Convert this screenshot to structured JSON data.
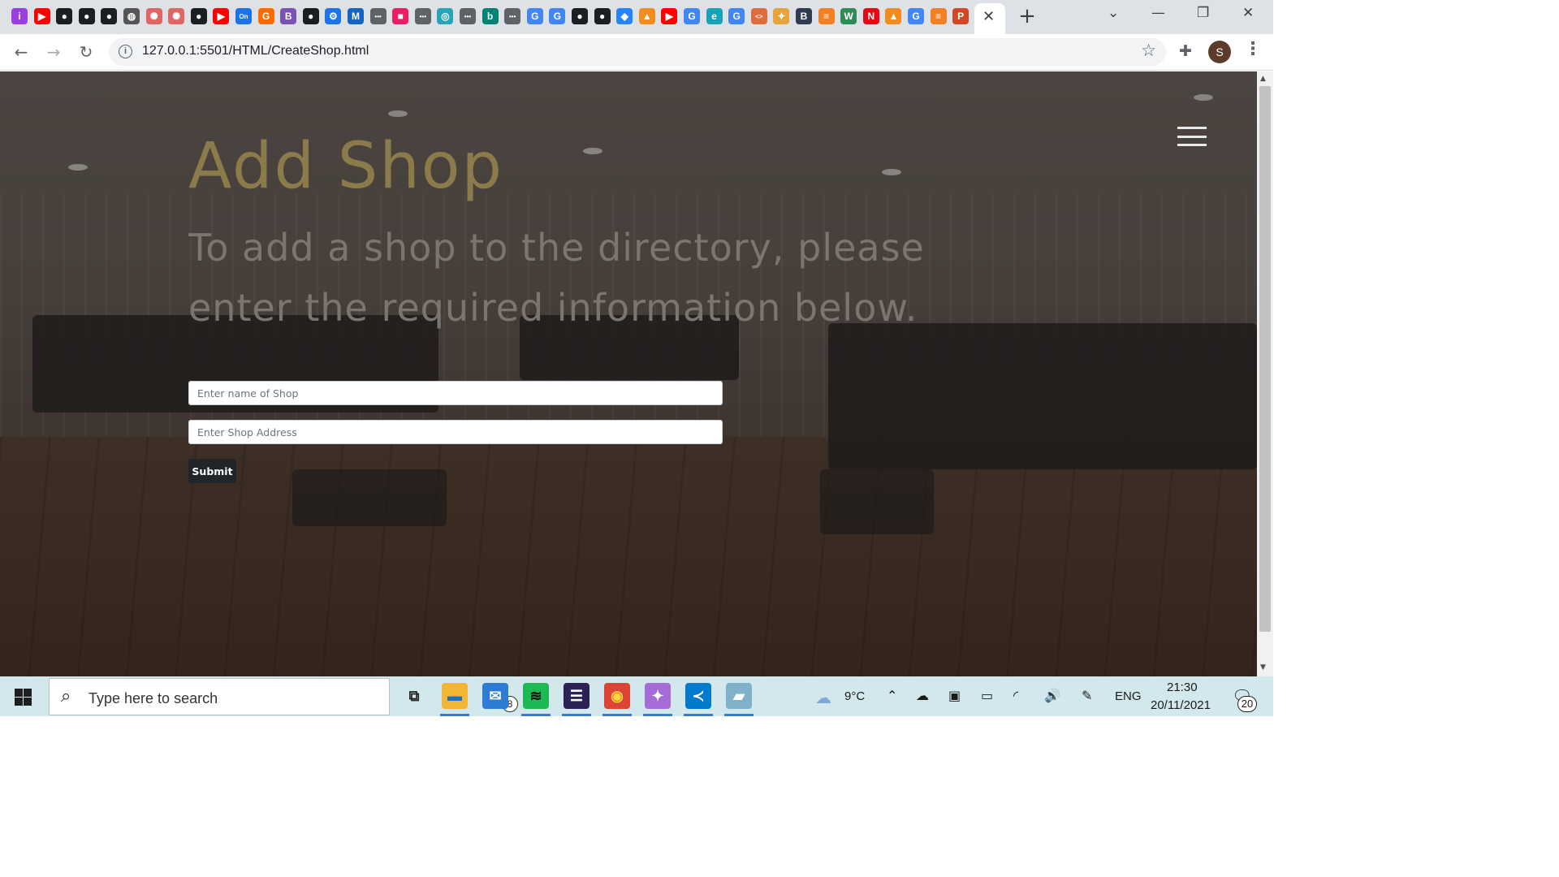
{
  "browser": {
    "tab_favicons": [
      {
        "name": "site-icon",
        "glyph": "i",
        "color": "#9b40e0"
      },
      {
        "name": "youtube-icon",
        "glyph": "▶",
        "color": "#ff0000"
      },
      {
        "name": "github-icon",
        "glyph": "●",
        "color": "#1b1f23"
      },
      {
        "name": "github-icon",
        "glyph": "●",
        "color": "#1b1f23"
      },
      {
        "name": "github-icon",
        "glyph": "●",
        "color": "#1b1f23"
      },
      {
        "name": "globe-icon",
        "glyph": "◍",
        "color": "#555555"
      },
      {
        "name": "openai-icon",
        "glyph": "✺",
        "color": "#e06565"
      },
      {
        "name": "openai-icon",
        "glyph": "✺",
        "color": "#e06565"
      },
      {
        "name": "github-icon",
        "glyph": "●",
        "color": "#1b1f23"
      },
      {
        "name": "youtube-icon",
        "glyph": "▶",
        "color": "#ff0000"
      },
      {
        "name": "on-icon",
        "glyph": "On",
        "color": "#1a73e8"
      },
      {
        "name": "g-icon",
        "glyph": "G",
        "color": "#ff6a00"
      },
      {
        "name": "bootstrap-icon",
        "glyph": "B",
        "color": "#7952b3"
      },
      {
        "name": "github-icon",
        "glyph": "●",
        "color": "#1b1f23"
      },
      {
        "name": "settings-icon",
        "glyph": "⚙",
        "color": "#1a73e8"
      },
      {
        "name": "mdn-icon",
        "glyph": "M",
        "color": "#1565c0"
      },
      {
        "name": "dots-icon",
        "glyph": "•••",
        "color": "#5f6368"
      },
      {
        "name": "app-icon",
        "glyph": "■",
        "color": "#e91e63"
      },
      {
        "name": "dots-icon",
        "glyph": "•••",
        "color": "#5f6368"
      },
      {
        "name": "app-icon",
        "glyph": "◎",
        "color": "#26a6b8"
      },
      {
        "name": "dots-icon",
        "glyph": "•••",
        "color": "#5f6368"
      },
      {
        "name": "bing-icon",
        "glyph": "b",
        "color": "#008373"
      },
      {
        "name": "dots-icon",
        "glyph": "•••",
        "color": "#5f6368"
      },
      {
        "name": "google-icon",
        "glyph": "G",
        "color": "#4285f4"
      },
      {
        "name": "google-icon",
        "glyph": "G",
        "color": "#4285f4"
      },
      {
        "name": "github-icon",
        "glyph": "●",
        "color": "#1b1f23"
      },
      {
        "name": "github-icon",
        "glyph": "●",
        "color": "#1b1f23"
      },
      {
        "name": "jira-icon",
        "glyph": "◆",
        "color": "#2684ff"
      },
      {
        "name": "app-icon",
        "glyph": "▲",
        "color": "#f28c1f"
      },
      {
        "name": "youtube-icon",
        "glyph": "▶",
        "color": "#ff0000"
      },
      {
        "name": "google-icon",
        "glyph": "G",
        "color": "#4285f4"
      },
      {
        "name": "app-icon",
        "glyph": "e",
        "color": "#17a2b8"
      },
      {
        "name": "google-icon",
        "glyph": "G",
        "color": "#4285f4"
      },
      {
        "name": "code-icon",
        "glyph": "<>",
        "color": "#e06c3c"
      },
      {
        "name": "app-icon",
        "glyph": "✦",
        "color": "#e8a33b"
      },
      {
        "name": "b-icon",
        "glyph": "B",
        "color": "#2f3b4f"
      },
      {
        "name": "stackoverflow-icon",
        "glyph": "≡",
        "color": "#f48024"
      },
      {
        "name": "w-icon",
        "glyph": "W",
        "color": "#2e8b57"
      },
      {
        "name": "netflix-icon",
        "glyph": "N",
        "color": "#e50914"
      },
      {
        "name": "app-icon",
        "glyph": "▲",
        "color": "#f28c1f"
      },
      {
        "name": "google-icon",
        "glyph": "G",
        "color": "#4285f4"
      },
      {
        "name": "stackoverflow-icon",
        "glyph": "≡",
        "color": "#f48024"
      },
      {
        "name": "powerpoint-icon",
        "glyph": "P",
        "color": "#d24726"
      }
    ],
    "active_tab_close": "✕",
    "new_tab": "+",
    "window_controls": {
      "tabsearch": "⌄",
      "minimize": "—",
      "restore": "❐",
      "close": "✕"
    },
    "nav": {
      "back": "←",
      "forward": "→",
      "reload": "↻"
    },
    "url": "127.0.0.1:5501/HTML/CreateShop.html",
    "profile_initial": "S"
  },
  "page": {
    "title": "Add Shop",
    "subtitle": "To add a shop to the directory, please enter the required information below.",
    "form": {
      "shop_name_placeholder": "Enter name of Shop",
      "shop_address_placeholder": "Enter Shop Address",
      "submit_label": "Submit"
    }
  },
  "taskbar": {
    "search_placeholder": "Type here to search",
    "apps": [
      {
        "name": "task-view-icon",
        "glyph": "⧉",
        "color": "#d3e8ec",
        "text_color": "#222222",
        "active": false
      },
      {
        "name": "file-explorer-icon",
        "glyph": "▬",
        "color": "#f2b632",
        "text_color": "#1d6fc4",
        "active": true
      },
      {
        "name": "mail-icon",
        "glyph": "✉",
        "color": "#2b7cd3",
        "text_color": "#ffffff",
        "active": false
      },
      {
        "name": "spotify-icon",
        "glyph": "≋",
        "color": "#1db954",
        "text_color": "#111111",
        "active": true
      },
      {
        "name": "eclipse-icon",
        "glyph": "☰",
        "color": "#2c2255",
        "text_color": "#ffffff",
        "active": true
      },
      {
        "name": "chrome-icon",
        "glyph": "◉",
        "color": "#db4437",
        "text_color": "#ffd43b",
        "active": true
      },
      {
        "name": "app-icon",
        "glyph": "✦",
        "color": "#a66bd6",
        "text_color": "#ffffff",
        "active": true
      },
      {
        "name": "vscode-icon",
        "glyph": "≺",
        "color": "#007acc",
        "text_color": "#ffffff",
        "active": true
      },
      {
        "name": "notes-icon",
        "glyph": "▰",
        "color": "#7fb1c9",
        "text_color": "#ffffff",
        "active": true
      }
    ],
    "mail_badge": "8",
    "weather": "9°C",
    "language": "ENG",
    "time": "21:30",
    "date": "20/11/2021",
    "notification_count": "20"
  }
}
